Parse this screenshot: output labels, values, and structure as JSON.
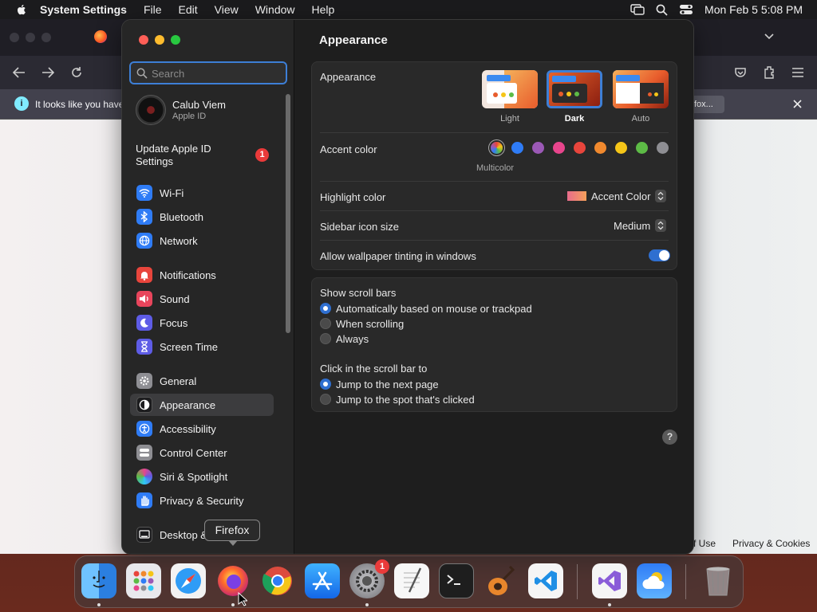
{
  "menubar": {
    "app_name": "System Settings",
    "items": [
      "File",
      "Edit",
      "View",
      "Window",
      "Help"
    ],
    "clock": "Mon Feb 5  5:08 PM"
  },
  "browser": {
    "notification_text": "It looks like you have",
    "notification_button": "fox...",
    "footer_links": [
      "f Use",
      "Privacy & Cookies"
    ]
  },
  "sidebar": {
    "search_placeholder": "Search",
    "account": {
      "name": "Calub Viem",
      "subtitle": "Apple ID"
    },
    "update": {
      "label": "Update Apple ID Settings",
      "badge": "1"
    },
    "items": [
      {
        "label": "Wi-Fi",
        "icon": "wifi-icon",
        "color": "#2f7cf6"
      },
      {
        "label": "Bluetooth",
        "icon": "bluetooth-icon",
        "color": "#2f7cf6"
      },
      {
        "label": "Network",
        "icon": "globe-icon",
        "color": "#2f7cf6"
      },
      {
        "label": "Notifications",
        "icon": "bell-icon",
        "color": "#e8453c"
      },
      {
        "label": "Sound",
        "icon": "speaker-icon",
        "color": "#e8455c"
      },
      {
        "label": "Focus",
        "icon": "moon-icon",
        "color": "#5e5ce6"
      },
      {
        "label": "Screen Time",
        "icon": "hourglass-icon",
        "color": "#5e5ce6"
      },
      {
        "label": "General",
        "icon": "gear-icon",
        "color": "#8e8e93"
      },
      {
        "label": "Appearance",
        "icon": "appearance-icon",
        "color": "#1c1c1e"
      },
      {
        "label": "Accessibility",
        "icon": "accessibility-icon",
        "color": "#2f7cf6"
      },
      {
        "label": "Control Center",
        "icon": "control-center-icon",
        "color": "#8e8e93"
      },
      {
        "label": "Siri & Spotlight",
        "icon": "siri-icon",
        "color": "#b84ad8"
      },
      {
        "label": "Privacy & Security",
        "icon": "hand-icon",
        "color": "#2f7cf6"
      },
      {
        "label": "Desktop & Dock",
        "icon": "desktop-icon",
        "color": "#1c1c1e"
      }
    ]
  },
  "content": {
    "title": "Appearance",
    "appearance_label": "Appearance",
    "appearance_options": [
      {
        "label": "Light",
        "selected": false
      },
      {
        "label": "Dark",
        "selected": true
      },
      {
        "label": "Auto",
        "selected": false
      }
    ],
    "accent_label": "Accent color",
    "accent_colors": [
      "#c8c8c8",
      "#2f7cf6",
      "#9b59b6",
      "#e8458c",
      "#e8453c",
      "#f0892e",
      "#f5c518",
      "#5dbb46",
      "#8e8e93"
    ],
    "accent_selected_name": "Multicolor",
    "highlight_label": "Highlight color",
    "highlight_value": "Accent Color",
    "icon_size_label": "Sidebar icon size",
    "icon_size_value": "Medium",
    "tinting_label": "Allow wallpaper tinting in windows",
    "tinting_on": true,
    "scroll_title": "Show scroll bars",
    "scroll_options": [
      {
        "label": "Automatically based on mouse or trackpad",
        "selected": true
      },
      {
        "label": "When scrolling",
        "selected": false
      },
      {
        "label": "Always",
        "selected": false
      }
    ],
    "click_title": "Click in the scroll bar to",
    "click_options": [
      {
        "label": "Jump to the next page",
        "selected": true
      },
      {
        "label": "Jump to the spot that's clicked",
        "selected": false
      }
    ],
    "help": "?"
  },
  "tooltip": "Firefox",
  "dock": {
    "apps": [
      "Finder",
      "Launchpad",
      "Safari",
      "Firefox",
      "Chrome",
      "App Store",
      "System Settings",
      "TextEdit",
      "Terminal",
      "GarageBand",
      "VS Code",
      "Visual Studio",
      "Weather",
      "Trash"
    ],
    "settings_badge": "1"
  }
}
